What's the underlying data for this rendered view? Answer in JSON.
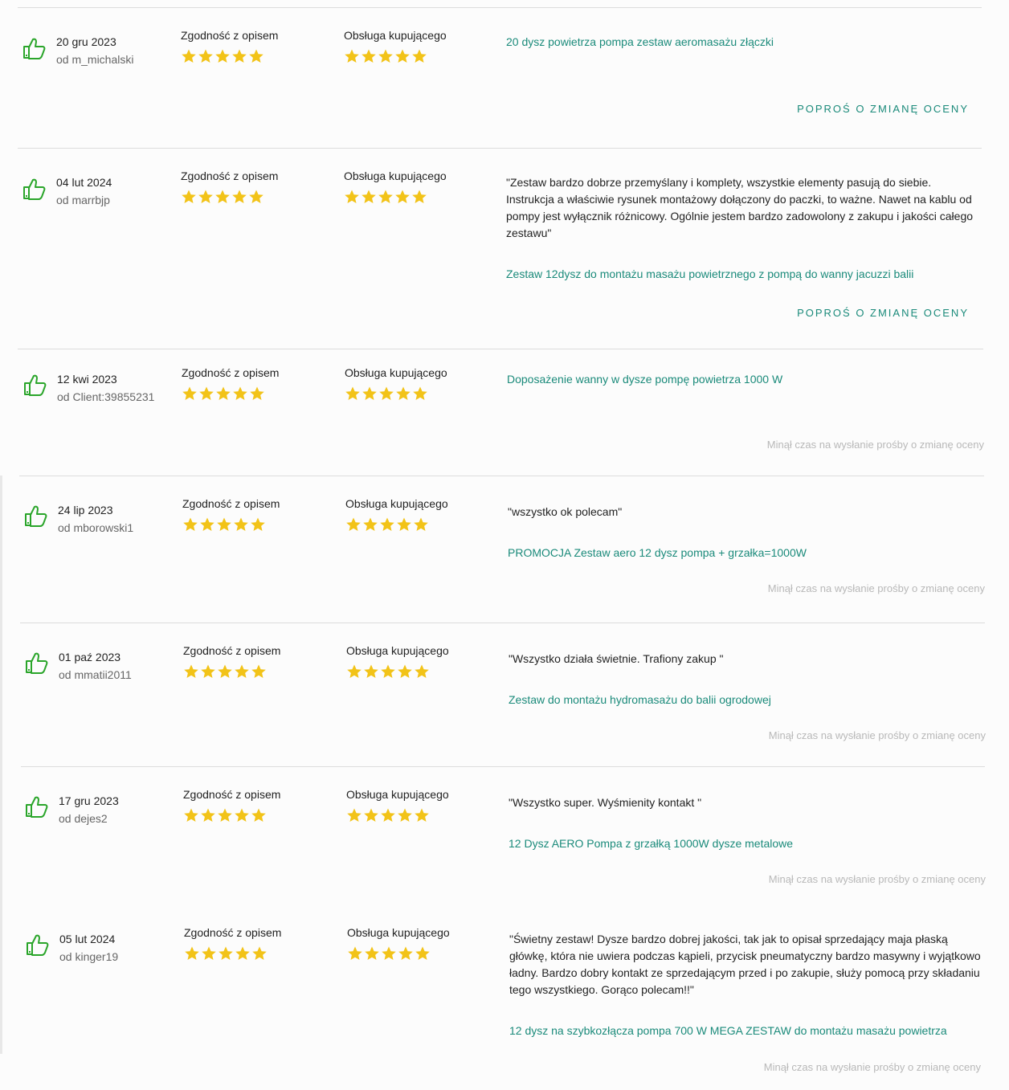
{
  "colors": {
    "accent": "#1a8a7a",
    "thumb_green": "#2aa52a",
    "star_yellow": "#f2c318",
    "muted": "#b8b8b8",
    "divider": "#dcdcdc"
  },
  "icons": {
    "thumb": "thumbs-up-icon",
    "star": "star-icon"
  },
  "labels": {
    "criterion1": "Zgodność z opisem",
    "criterion2": "Obsługa kupującego"
  },
  "reviews": [
    {
      "date": "20 gru 2023",
      "author": "od m_michalski",
      "rating_description": 5,
      "rating_service": 5,
      "comment": "",
      "product": "20 dysz powietrza pompa zestaw aeromasażu złączki",
      "action": "POPROŚ O ZMIANĘ OCENY",
      "expired": ""
    },
    {
      "date": "04 lut 2024",
      "author": "od marrbjp",
      "rating_description": 5,
      "rating_service": 5,
      "comment": "\"Zestaw bardzo dobrze przemyślany i komplety, wszystkie elementy pasują do siebie. Instrukcja a właściwie rysunek montażowy dołączony do paczki, to ważne. Nawet na kablu od pompy jest wyłącznik różnicowy. Ogólnie jestem bardzo zadowolony z zakupu i jakości całego zestawu\"",
      "product": "Zestaw 12dysz do montażu masażu powietrznego z pompą do wanny jacuzzi balii",
      "action": "POPROŚ O ZMIANĘ OCENY",
      "expired": ""
    },
    {
      "date": "12 kwi 2023",
      "author": "od Client:39855231",
      "rating_description": 5,
      "rating_service": 5,
      "comment": "",
      "product": "Doposażenie wanny w dysze pompę powietrza 1000 W",
      "action": "",
      "expired": "Minął czas na wysłanie prośby o zmianę oceny"
    },
    {
      "date": "24 lip 2023",
      "author": "od mborowski1",
      "rating_description": 5,
      "rating_service": 5,
      "comment": "\"wszystko ok polecam\"",
      "product": "PROMOCJA Zestaw aero 12 dysz pompa + grzałka=1000W",
      "action": "",
      "expired": "Minął czas na wysłanie prośby o zmianę oceny"
    },
    {
      "date": "01 paź 2023",
      "author": "od mmatii2011",
      "rating_description": 5,
      "rating_service": 5,
      "comment": "\"Wszystko działa świetnie. Trafiony zakup \"",
      "product": "Zestaw do montażu hydromasażu do balii ogrodowej",
      "action": "",
      "expired": "Minął czas na wysłanie prośby o zmianę oceny"
    },
    {
      "date": "17 gru 2023",
      "author": "od dejes2",
      "rating_description": 5,
      "rating_service": 5,
      "comment": "\"Wszystko super. Wyśmienity kontakt \"",
      "product": "12 Dysz AERO Pompa z grzałką 1000W dysze metalowe",
      "action": "",
      "expired": "Minął czas na wysłanie prośby o zmianę oceny"
    },
    {
      "date": "05 lut 2024",
      "author": "od kinger19",
      "rating_description": 5,
      "rating_service": 5,
      "comment": "\"Świetny zestaw! Dysze bardzo dobrej jakości, tak jak to opisał sprzedający maja płaską główkę, która nie uwiera podczas kąpieli, przycisk pneumatyczny bardzo masywny i wyjątkowo ładny. Bardzo dobry kontakt ze sprzedającym przed i po zakupie, służy pomocą przy składaniu tego wszystkiego. Gorąco polecam!!\"",
      "product": "12 dysz na szybkozłącza pompa 700 W MEGA ZESTAW do montażu masażu powietrza",
      "action": "",
      "expired": "Minął czas na wysłanie prośby o zmianę oceny"
    }
  ]
}
